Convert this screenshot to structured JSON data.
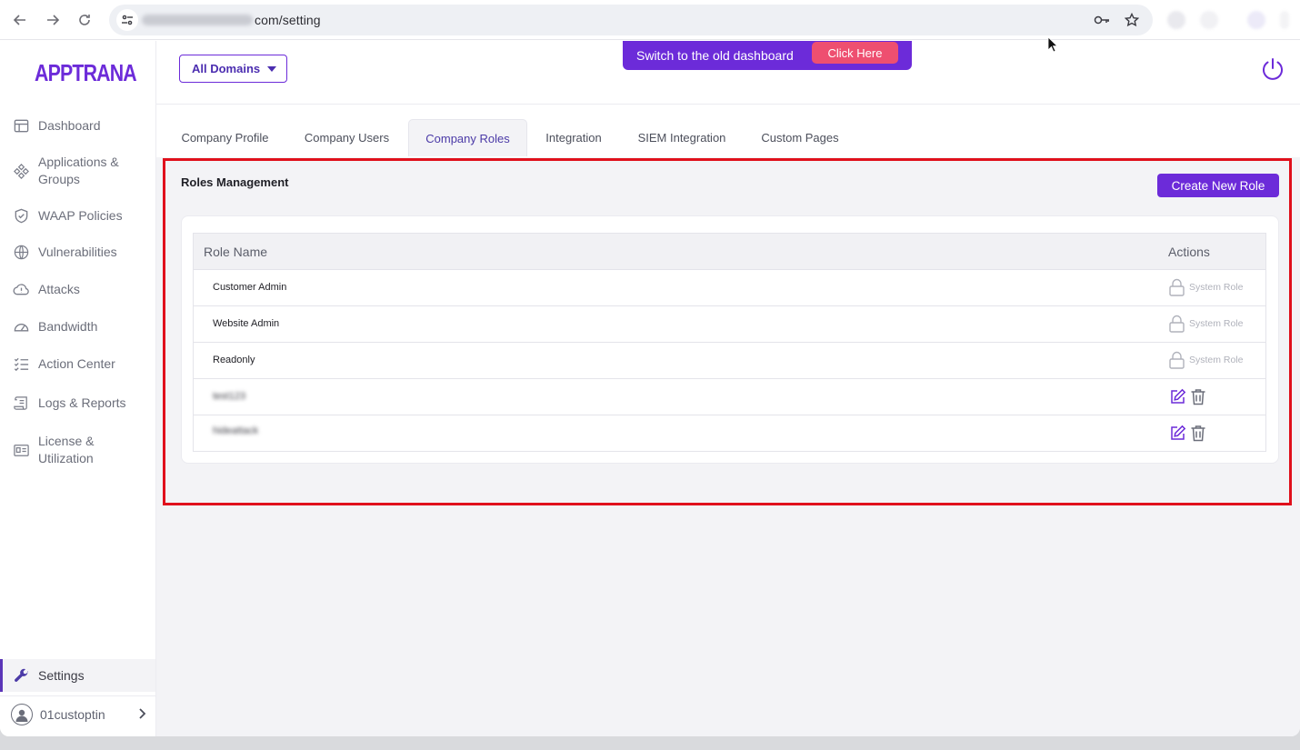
{
  "browser": {
    "url_text": "com/setting",
    "back_icon": "arrow-left-icon",
    "forward_icon": "arrow-right-icon",
    "reload_icon": "reload-icon",
    "key_icon": "key-icon",
    "star_icon": "star-icon"
  },
  "app": {
    "logo": "APPTRANA",
    "accent_color": "#6c2bd9"
  },
  "topbar": {
    "domain_select": "All Domains",
    "banner_text": "Switch to the old dashboard",
    "banner_button": "Click Here"
  },
  "sidebar": {
    "items": [
      {
        "label": "Dashboard",
        "icon": "layout-icon"
      },
      {
        "label": "Applications & Groups",
        "icon": "diamond-grid-icon"
      },
      {
        "label": "WAAP Policies",
        "icon": "shield-icon"
      },
      {
        "label": "Vulnerabilities",
        "icon": "bug-icon"
      },
      {
        "label": "Attacks",
        "icon": "cloud-alert-icon"
      },
      {
        "label": "Bandwidth",
        "icon": "gauge-icon"
      },
      {
        "label": "Action Center",
        "icon": "checklist-icon"
      },
      {
        "label": "Logs & Reports",
        "icon": "scroll-icon"
      },
      {
        "label": "License & Utilization",
        "icon": "id-card-icon"
      }
    ],
    "settings": "Settings",
    "user": "01custoptin"
  },
  "tabs": [
    {
      "label": "Company Profile"
    },
    {
      "label": "Company Users"
    },
    {
      "label": "Company Roles",
      "active": true
    },
    {
      "label": "Integration"
    },
    {
      "label": "SIEM Integration"
    },
    {
      "label": "Custom Pages"
    }
  ],
  "roles": {
    "title": "Roles Management",
    "create_button": "Create New Role",
    "columns": {
      "name": "Role Name",
      "actions": "Actions"
    },
    "system_role_label": "System Role",
    "rows": [
      {
        "name": "Customer Admin",
        "type": "system"
      },
      {
        "name": "Website Admin",
        "type": "system"
      },
      {
        "name": "Readonly",
        "type": "system"
      },
      {
        "name": "test123",
        "type": "custom"
      },
      {
        "name": "hideattack",
        "type": "custom"
      }
    ]
  }
}
